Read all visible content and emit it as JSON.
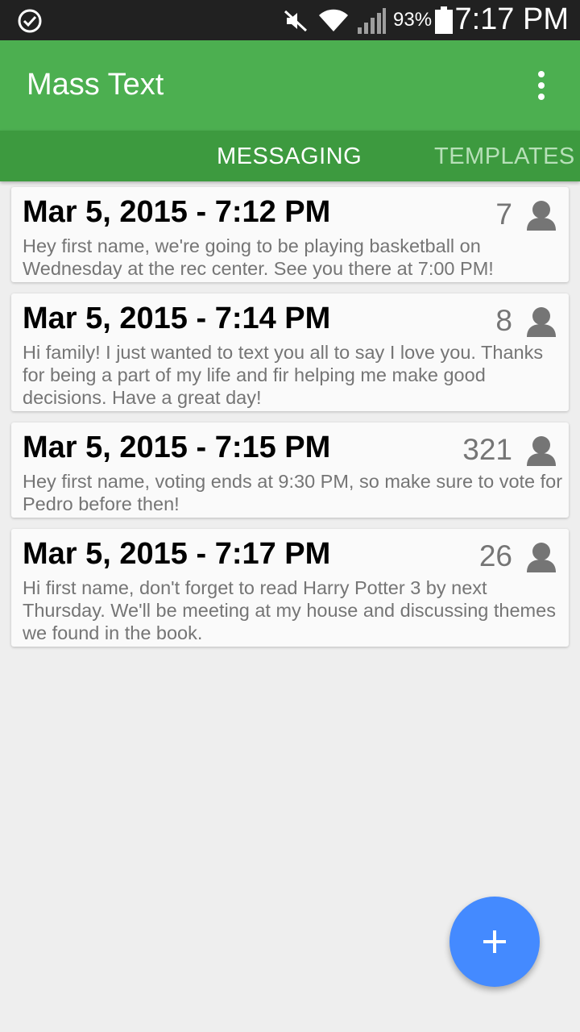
{
  "status_bar": {
    "icons": [
      "check-circle-icon",
      "mute-icon",
      "wifi-icon",
      "signal-icon",
      "battery-icon"
    ],
    "battery": "93%",
    "time": "7:17 PM"
  },
  "app_bar": {
    "title": "Mass Text",
    "menu_icon": "more-vert-icon",
    "color": "#4caf50"
  },
  "tabs": [
    {
      "label": "MESSAGING",
      "selected": true
    },
    {
      "label": "TEMPLATES",
      "selected": false
    }
  ],
  "messages": [
    {
      "date": "Mar 5, 2015 - 7:12 PM",
      "recipients": "7",
      "text": "Hey first name, we're going to be playing basketball on Wednesday at the rec center. See you there at 7:00 PM!"
    },
    {
      "date": "Mar 5, 2015 - 7:14 PM",
      "recipients": "8",
      "text": "Hi family! I just wanted to text you all to say I love you. Thanks for being a part of my life and fir helping me make good decisions. Have a great day!"
    },
    {
      "date": "Mar 5, 2015 - 7:15 PM",
      "recipients": "321",
      "text": "Hey first name, voting ends at 9:30 PM, so make sure to vote for Pedro before then!"
    },
    {
      "date": "Mar 5, 2015 - 7:17 PM",
      "recipients": "26",
      "text": "Hi first name, don't forget to read Harry Potter 3 by next Thursday. We'll be meeting at my house and discussing themes we found in the book."
    }
  ],
  "fab": {
    "icon": "plus-icon",
    "color": "#448aff"
  }
}
